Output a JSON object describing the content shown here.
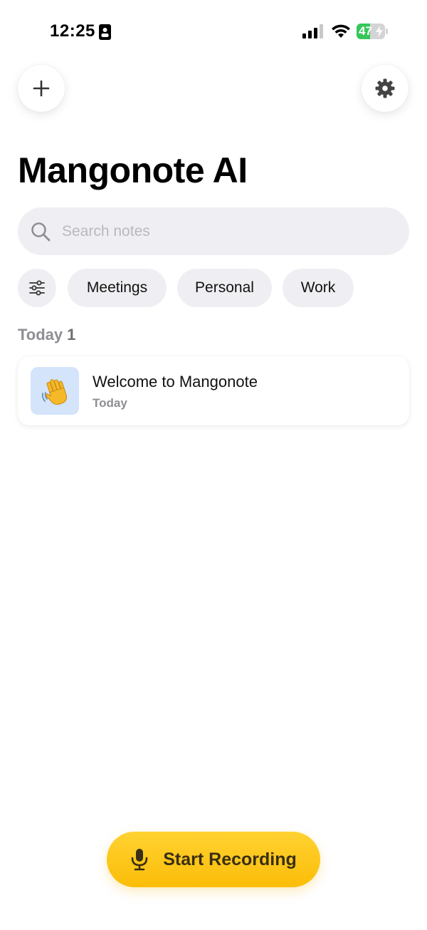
{
  "status_bar": {
    "time": "12:25",
    "battery_percent": "47",
    "battery_level": 0.47,
    "battery_color": "#35c759",
    "icons": [
      "id-card-icon",
      "cellular-signal-icon",
      "wifi-icon",
      "battery-charging-icon"
    ]
  },
  "header": {
    "add_icon": "plus-icon",
    "settings_icon": "gear-icon"
  },
  "title": "Mangonote AI",
  "search": {
    "placeholder": "Search notes",
    "value": "",
    "icon": "search-icon"
  },
  "filters": {
    "icon": "sliders-icon",
    "chips": [
      "Meetings",
      "Personal",
      "Work"
    ]
  },
  "sections": [
    {
      "label": "Today",
      "count": "1",
      "notes": [
        {
          "emoji": "👋",
          "title": "Welcome to Mangonote",
          "date": "Today"
        }
      ]
    }
  ],
  "record_button": {
    "label": "Start Recording",
    "icon": "microphone-icon",
    "color": "#fbc41a"
  }
}
